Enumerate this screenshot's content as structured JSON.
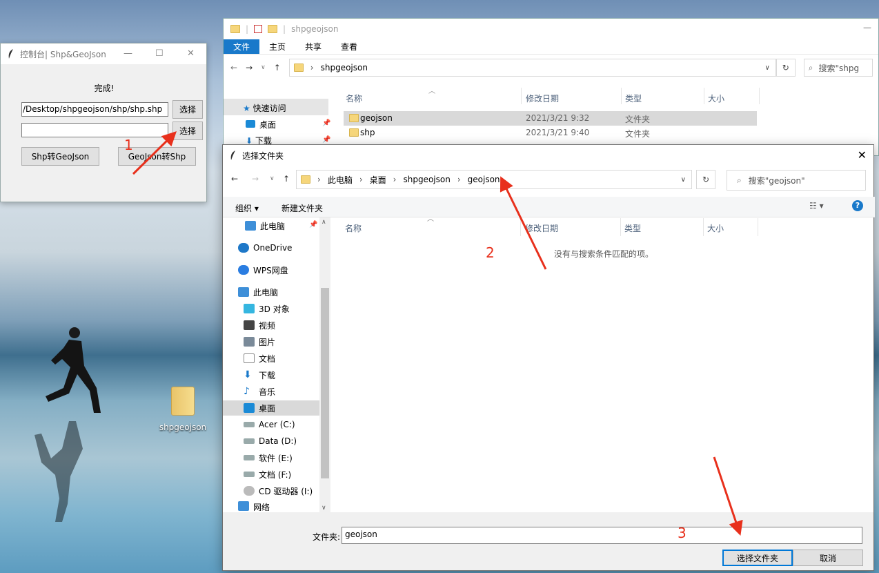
{
  "desktop": {
    "icon_label": "shpgeojson"
  },
  "tk_window": {
    "title": "控制台| Shp&GeoJson",
    "status": "完成!",
    "shp_path_value": "/Desktop/shpgeojson/shp/shp.shp",
    "geojson_path_value": "",
    "choose_label_1": "选择",
    "choose_label_2": "选择",
    "shp_to_geojson_label": "Shp转GeoJson",
    "geojson_to_shp_label": "GeoJson转Shp"
  },
  "explorer": {
    "title": "shpgeojson",
    "ribbon_tabs": [
      "文件",
      "主页",
      "共享",
      "查看"
    ],
    "address": "shpgeojson",
    "search_placeholder": "搜索\"shpg",
    "columns": [
      "名称",
      "修改日期",
      "类型",
      "大小"
    ],
    "nav": {
      "quick_access": "快速访问",
      "desktop": "桌面",
      "downloads": "下载"
    },
    "rows": [
      {
        "name": "geojson",
        "date": "2021/3/21 9:32",
        "type": "文件夹"
      },
      {
        "name": "shp",
        "date": "2021/3/21 9:40",
        "type": "文件夹"
      }
    ]
  },
  "dialog": {
    "title": "选择文件夹",
    "breadcrumb": [
      "此电脑",
      "桌面",
      "shpgeojson",
      "geojson"
    ],
    "search_placeholder": "搜索\"geojson\"",
    "organize_label": "组织 ▾",
    "new_folder_label": "新建文件夹",
    "columns": [
      "名称",
      "修改日期",
      "类型",
      "大小"
    ],
    "empty_message": "没有与搜索条件匹配的项。",
    "nav_items": [
      {
        "label": "此电脑",
        "icon": "computer-icon"
      },
      {
        "label": "OneDrive",
        "icon": "cloud-icon"
      },
      {
        "label": "WPS网盘",
        "icon": "cloud-icon"
      },
      {
        "label": "此电脑",
        "icon": "computer-icon"
      },
      {
        "label": "3D 对象",
        "icon": "cube-icon"
      },
      {
        "label": "视频",
        "icon": "video-icon"
      },
      {
        "label": "图片",
        "icon": "picture-icon"
      },
      {
        "label": "文档",
        "icon": "document-icon"
      },
      {
        "label": "下载",
        "icon": "download-icon"
      },
      {
        "label": "音乐",
        "icon": "music-icon"
      },
      {
        "label": "桌面",
        "icon": "desktop-icon"
      },
      {
        "label": "Acer (C:)",
        "icon": "drive-icon"
      },
      {
        "label": "Data (D:)",
        "icon": "drive-icon"
      },
      {
        "label": "软件 (E:)",
        "icon": "drive-icon"
      },
      {
        "label": "文档 (F:)",
        "icon": "drive-icon"
      },
      {
        "label": "CD 驱动器 (I:)",
        "icon": "cd-icon"
      },
      {
        "label": "网络",
        "icon": "network-icon"
      }
    ],
    "folder_label": "文件夹:",
    "folder_value": "geojson",
    "select_button": "选择文件夹",
    "cancel_button": "取消"
  },
  "annotations": [
    "1",
    "2",
    "3"
  ],
  "colors": {
    "accent": "#1979ca",
    "annotation": "#e8301c"
  }
}
